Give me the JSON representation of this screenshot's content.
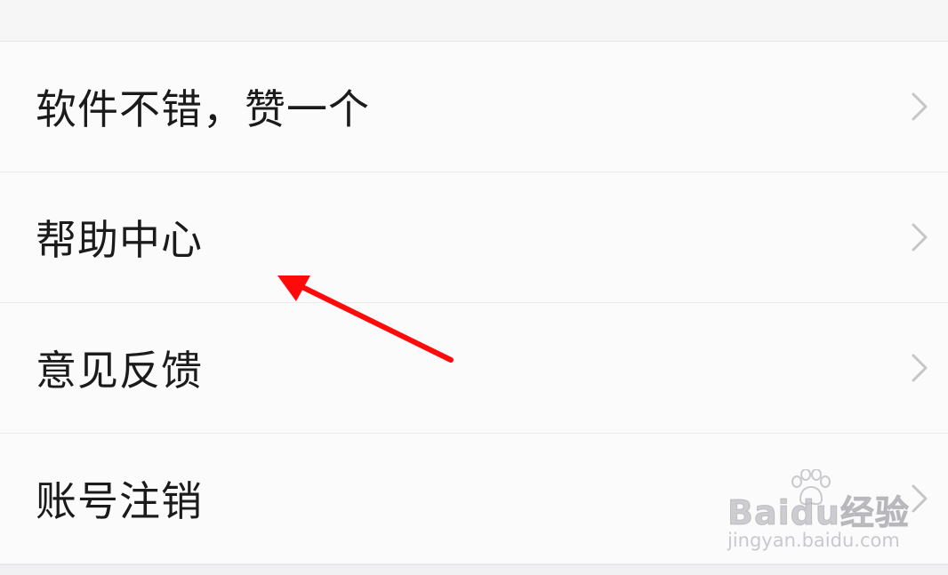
{
  "menu": {
    "items": [
      {
        "label": "软件不错，赞一个"
      },
      {
        "label": "帮助中心"
      },
      {
        "label": "意见反馈"
      },
      {
        "label": "账号注销"
      }
    ]
  },
  "watermark": {
    "logo_text": "Baidu经验",
    "url": "jingyan.baidu.com"
  },
  "colors": {
    "annotation_arrow": "#ff0000",
    "chevron": "#c6c6c9",
    "text": "#1b1b1b",
    "background": "#fbfbfc",
    "divider": "#ececee"
  }
}
